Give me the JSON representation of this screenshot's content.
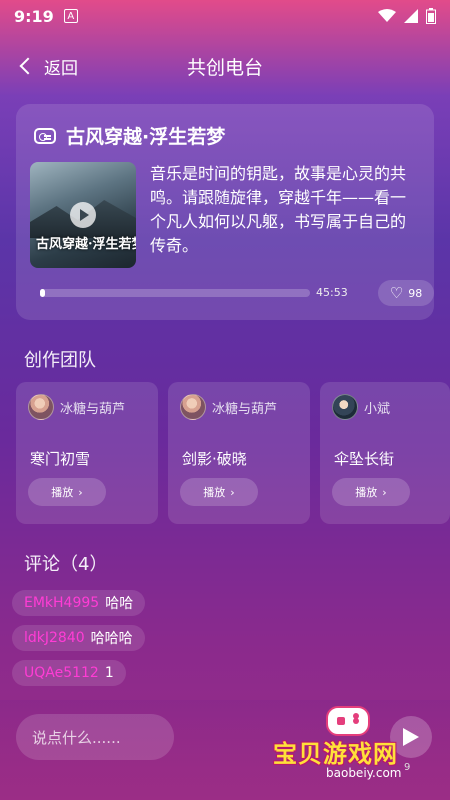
{
  "status_bar": {
    "time": "9:19",
    "notification": "A"
  },
  "header": {
    "back_label": "返回",
    "title": "共创电台"
  },
  "radio": {
    "title": "古风穿越·浮生若梦",
    "cover_text": "古风穿越·浮生若梦",
    "description": "音乐是时间的钥匙，故事是心灵的共鸣。请跟随旋律，穿越千年——看一个凡人如何以凡躯，书写属于自己的传奇。",
    "progress_fraction": 0.02,
    "duration": "45:53",
    "likes": "98"
  },
  "team": {
    "section_title": "创作团队",
    "play_label": "播放",
    "members": [
      {
        "name": "冰糖与葫芦",
        "song": "寒门初雪"
      },
      {
        "name": "冰糖与葫芦",
        "song": "剑影·破晓"
      },
      {
        "name": "小斌",
        "song": "伞坠长街"
      }
    ]
  },
  "comments": {
    "section_title": "评论（4）",
    "items": [
      {
        "user": "EMkH4995",
        "text": "哈哈"
      },
      {
        "user": "ldkJ2840",
        "text": "哈哈哈"
      },
      {
        "user": "UQAe5112",
        "text": "1"
      }
    ]
  },
  "composer": {
    "placeholder": "说点什么......",
    "count_tail": "9"
  },
  "watermark": {
    "title": "宝贝游戏网",
    "url": "baobeiy.com"
  },
  "colors": {
    "comment_user": "#ff3cd5",
    "watermark_yellow": "#ffe03a",
    "watermark_pink": "#e43e7c"
  }
}
